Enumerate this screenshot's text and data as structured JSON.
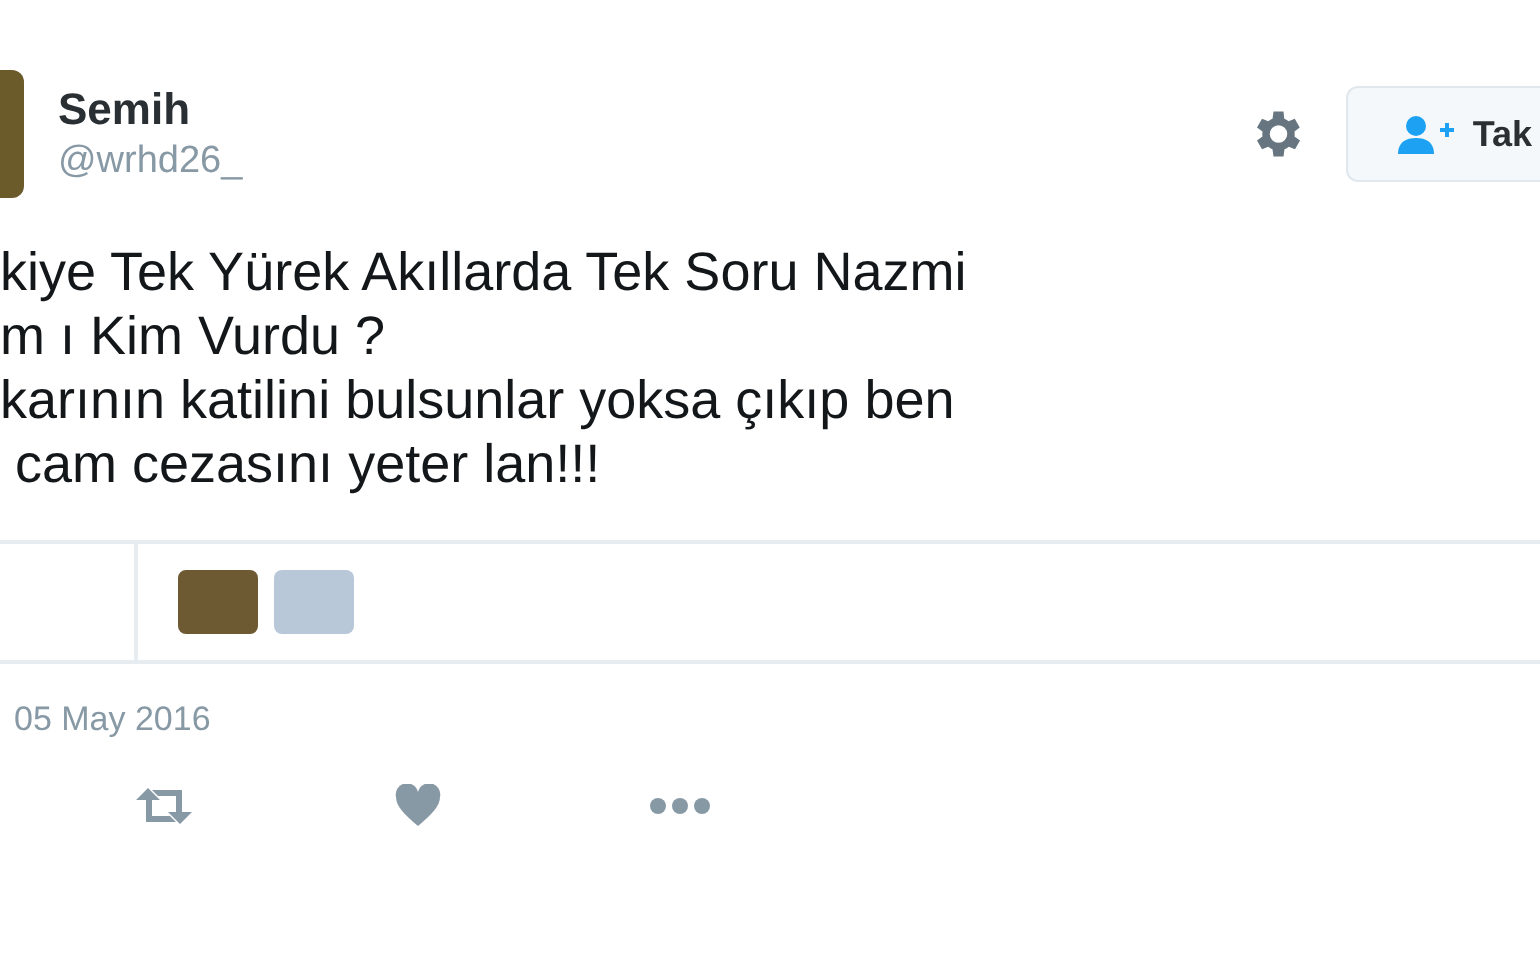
{
  "author": {
    "name": "Semih",
    "handle": "@wrhd26_"
  },
  "follow_button": {
    "label": "Tak"
  },
  "tweet_lines": [
    "kiye Tek Yürek Akıllarda Tek Soru Nazmi",
    "m ı Kim Vurdu ?",
    "karının katilini bulsunlar yoksa çıkıp ben",
    " cam cezasını yeter lan!!!"
  ],
  "likers": [
    {
      "kind": "photo"
    },
    {
      "kind": "photo"
    }
  ],
  "date": "05 May 2016"
}
